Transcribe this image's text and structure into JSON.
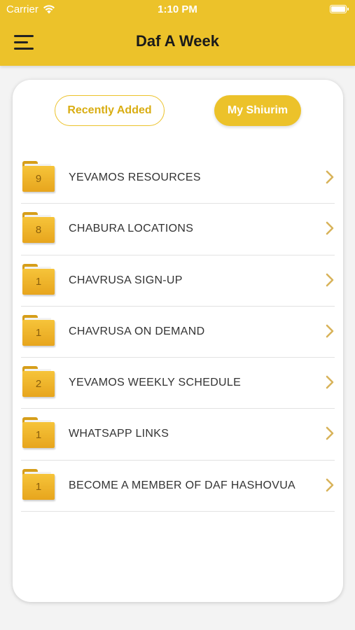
{
  "status_bar": {
    "carrier": "Carrier",
    "time": "1:10 PM"
  },
  "nav": {
    "title": "Daf A Week",
    "menu_icon": "hamburger-icon"
  },
  "tabs": {
    "recent": "Recently Added",
    "mine": "My Shiurim"
  },
  "colors": {
    "accent": "#ecc22a",
    "folder": "#f0b32a",
    "chevron": "#d8b35a"
  },
  "items": [
    {
      "count": "9",
      "label": "YEVAMOS RESOURCES"
    },
    {
      "count": "8",
      "label": "CHABURA LOCATIONS"
    },
    {
      "count": "1",
      "label": "CHAVRUSA SIGN-UP"
    },
    {
      "count": "1",
      "label": "CHAVRUSA ON DEMAND"
    },
    {
      "count": "2",
      "label": "YEVAMOS WEEKLY SCHEDULE"
    },
    {
      "count": "1",
      "label": "WHATSAPP LINKS"
    },
    {
      "count": "1",
      "label": "BECOME A MEMBER OF DAF HASHOVUA"
    }
  ]
}
